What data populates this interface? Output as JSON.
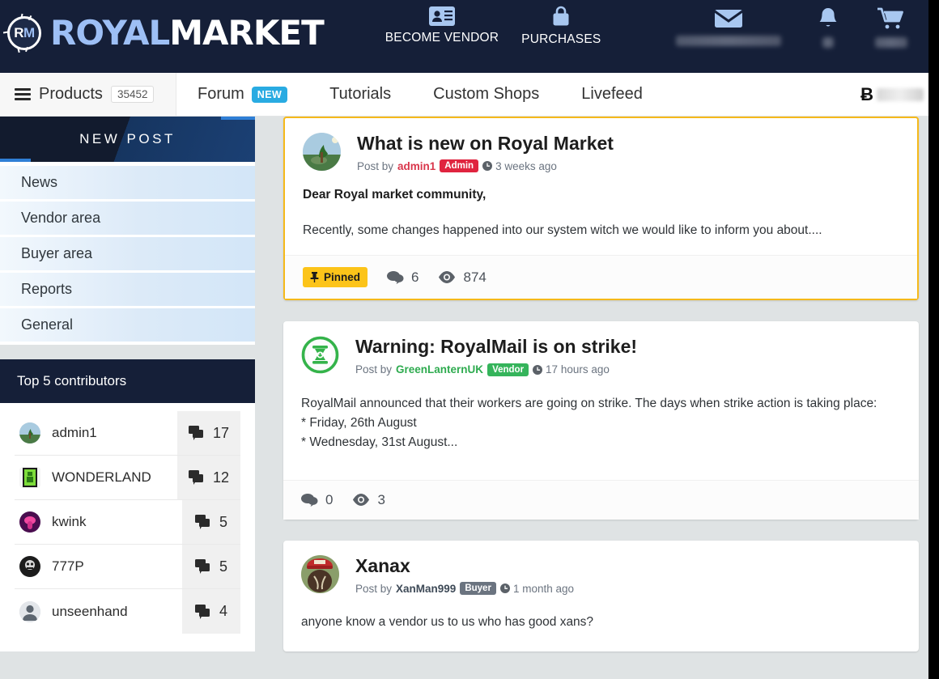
{
  "brand": {
    "logo_first": "ROYAL",
    "logo_second": "MARKET",
    "logo_mark_initials": "RM"
  },
  "header": {
    "items": [
      {
        "label": "BECOME VENDOR",
        "icon": "id-card-icon"
      },
      {
        "label": "PURCHASES",
        "icon": "shopping-bag-icon"
      }
    ],
    "right_items": [
      {
        "icon": "envelope-icon",
        "value_redacted": true
      },
      {
        "icon": "bell-icon",
        "value_redacted": true
      },
      {
        "icon": "cart-icon",
        "value_redacted": true
      }
    ]
  },
  "navbar": {
    "products_label": "Products",
    "products_count": "35452",
    "links": [
      {
        "label": "Forum",
        "badge": "NEW"
      },
      {
        "label": "Tutorials",
        "badge": ""
      },
      {
        "label": "Custom Shops",
        "badge": ""
      },
      {
        "label": "Livefeed",
        "badge": ""
      }
    ],
    "btc_symbol": "Ƀ",
    "btc_value_redacted": true
  },
  "sidebar": {
    "new_post_label": "NEW POST",
    "categories": [
      {
        "label": "News"
      },
      {
        "label": "Vendor area"
      },
      {
        "label": "Buyer area"
      },
      {
        "label": "Reports"
      },
      {
        "label": "General"
      }
    ],
    "contributors_panel": {
      "title": "Top 5 contributors",
      "rows": [
        {
          "name": "admin1",
          "count": "17",
          "avatar": "landscape-tree"
        },
        {
          "name": "WONDERLAND",
          "count": "12",
          "avatar": "green-pixel"
        },
        {
          "name": "kwink",
          "count": "5",
          "avatar": "pink-creature"
        },
        {
          "name": "777P",
          "count": "5",
          "avatar": "dark-photo"
        },
        {
          "name": "unseenhand",
          "count": "4",
          "avatar": "default-user"
        }
      ]
    }
  },
  "posts": [
    {
      "title": "What is new on Royal Market",
      "post_by_label": "Post by",
      "author": "admin1",
      "role": "Admin",
      "role_type": "admin",
      "time": "3 weeks ago",
      "avatar": "landscape-tree",
      "pinned": true,
      "pinned_label": "Pinned",
      "lead": "Dear Royal market community,",
      "lines": [
        "Recently, some changes happened into our system witch we would like to inform you about...."
      ],
      "comments": "6",
      "views": "874"
    },
    {
      "title": "Warning: RoyalMail is on strike!",
      "post_by_label": "Post by",
      "author": "GreenLanternUK",
      "role": "Vendor",
      "role_type": "vendor",
      "time": "17 hours ago",
      "avatar": "green-lantern",
      "pinned": false,
      "lead": "",
      "lines": [
        "RoyalMail announced that their workers are going on strike. The days when strike action is taking place:",
        "* Friday, 26th August",
        "* Wednesday, 31st August..."
      ],
      "comments": "0",
      "views": "3"
    },
    {
      "title": "Xanax",
      "post_by_label": "Post by",
      "author": "XanMan999",
      "role": "Buyer",
      "role_type": "buyer",
      "time": "1 month ago",
      "avatar": "red-cap-photo",
      "pinned": false,
      "lead": "",
      "lines": [
        "anyone know a vendor us to us who has good xans?"
      ],
      "comments": "",
      "views": ""
    }
  ],
  "colors": {
    "header_bg": "#151f38",
    "accent_blue": "#9dbff5",
    "badge_new": "#29abe2",
    "pinned_yellow": "#fcc419",
    "admin_red": "#e0243f",
    "vendor_green": "#35b45b",
    "buyer_gray": "#6b7480",
    "page_bg": "#dfe3e4"
  }
}
